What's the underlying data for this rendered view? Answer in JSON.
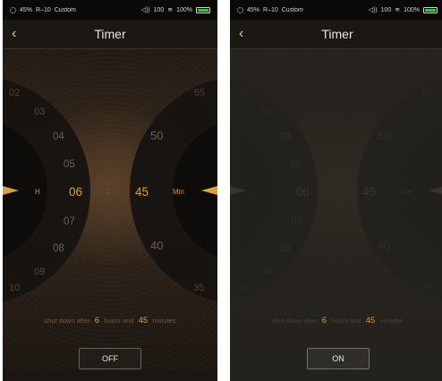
{
  "status_bar": {
    "battery_percent_left": "45%",
    "preset": "R–10",
    "eq_mode": "Custom",
    "volume": "100",
    "battery": "100%"
  },
  "header": {
    "title": "Timer"
  },
  "hour_wheel": {
    "unit_label": "H",
    "selected": "06",
    "visible_values": [
      "02",
      "03",
      "04",
      "05",
      "06",
      "07",
      "08",
      "09",
      "10"
    ]
  },
  "separator": ":",
  "minute_wheel": {
    "unit_label": "Min",
    "selected": "45",
    "visible_values": [
      "55",
      "50",
      "45",
      "40",
      "35"
    ]
  },
  "summary": {
    "prefix": "shut down after",
    "hours": "6",
    "middle": "hours and",
    "minutes": "45",
    "suffix": "minutes"
  },
  "buttons": {
    "off": "OFF",
    "on": "ON"
  },
  "colors": {
    "accent": "#d6a043",
    "battery_green": "#38c53c"
  },
  "icons": [
    "brightness-icon",
    "volume-icon",
    "wifi-icon",
    "battery-icon",
    "back-icon",
    "pointer-left-icon",
    "pointer-right-icon"
  ]
}
